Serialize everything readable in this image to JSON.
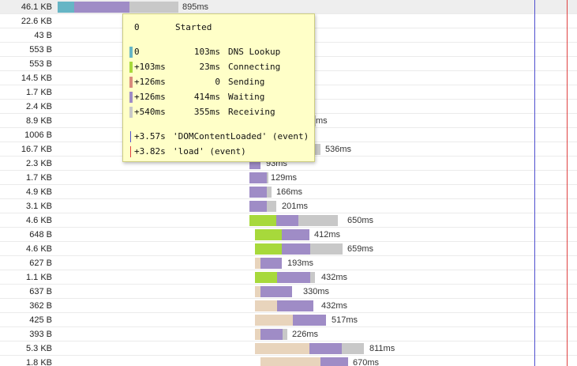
{
  "colors": {
    "blocked": "#e8d4bc",
    "dns": "#66b5c5",
    "connecting": "#a7d93b",
    "sending": "#d98b7d",
    "waiting": "#9f8cc6",
    "receiving": "#c8c8c8",
    "dom_content_loaded": "#4f4fcf",
    "load": "#e04040"
  },
  "requests": [
    {
      "size": "46.1 KB",
      "duration": "895ms",
      "highlighted": true
    },
    {
      "size": "22.6 KB",
      "duration": ""
    },
    {
      "size": "43 B",
      "duration": ""
    },
    {
      "size": "553 B",
      "duration": ""
    },
    {
      "size": "553 B",
      "duration": ""
    },
    {
      "size": "14.5 KB",
      "duration": ""
    },
    {
      "size": "1.7 KB",
      "duration": ""
    },
    {
      "size": "2.4 KB",
      "duration": ""
    },
    {
      "size": "8.9 KB",
      "duration": "ms"
    },
    {
      "size": "1006 B",
      "duration": ""
    },
    {
      "size": "16.7 KB",
      "duration": "536ms"
    },
    {
      "size": "2.3 KB",
      "duration": "93ms"
    },
    {
      "size": "1.7 KB",
      "duration": "129ms"
    },
    {
      "size": "4.9 KB",
      "duration": "166ms"
    },
    {
      "size": "3.1 KB",
      "duration": "201ms"
    },
    {
      "size": "4.6 KB",
      "duration": "650ms"
    },
    {
      "size": "648 B",
      "duration": "412ms"
    },
    {
      "size": "4.6 KB",
      "duration": "659ms"
    },
    {
      "size": "627 B",
      "duration": "193ms"
    },
    {
      "size": "1.1 KB",
      "duration": "432ms"
    },
    {
      "size": "637 B",
      "duration": "330ms"
    },
    {
      "size": "362 B",
      "duration": "432ms"
    },
    {
      "size": "425 B",
      "duration": "517ms"
    },
    {
      "size": "393 B",
      "duration": "226ms"
    },
    {
      "size": "5.3 KB",
      "duration": "811ms"
    },
    {
      "size": "1.8 KB",
      "duration": "670ms"
    }
  ],
  "tooltip": {
    "started": {
      "value": "0",
      "label": "Started"
    },
    "phases": [
      {
        "start": "0",
        "duration": "103ms",
        "label": "DNS Lookup",
        "color_key": "dns"
      },
      {
        "start": "+103ms",
        "duration": "23ms",
        "label": "Connecting",
        "color_key": "connecting"
      },
      {
        "start": "+126ms",
        "duration": "0",
        "label": "Sending",
        "color_key": "sending"
      },
      {
        "start": "+126ms",
        "duration": "414ms",
        "label": "Waiting",
        "color_key": "waiting"
      },
      {
        "start": "+540ms",
        "duration": "355ms",
        "label": "Receiving",
        "color_key": "receiving"
      }
    ],
    "events": [
      {
        "time": "+3.57s",
        "label": "'DOMContentLoaded' (event)",
        "color_key": "dom_content_loaded"
      },
      {
        "time": "+3.82s",
        "label": "'load' (event)",
        "color_key": "load"
      }
    ]
  }
}
